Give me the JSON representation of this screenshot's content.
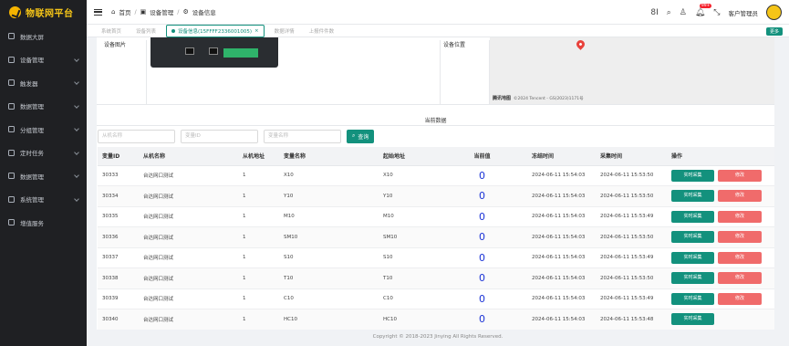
{
  "app": {
    "title": "物联网平台"
  },
  "sidebar": {
    "items": [
      {
        "label": "数据大屏",
        "icon": "monitor-icon",
        "has_children": false
      },
      {
        "label": "设备管理",
        "icon": "device-icon",
        "has_children": true
      },
      {
        "label": "触发器",
        "icon": "trigger-icon",
        "has_children": true
      },
      {
        "label": "数据管理",
        "icon": "data-icon",
        "has_children": true
      },
      {
        "label": "分组管理",
        "icon": "group-icon",
        "has_children": true
      },
      {
        "label": "定时任务",
        "icon": "clock-icon",
        "has_children": true
      },
      {
        "label": "数据管理",
        "icon": "data-icon",
        "has_children": true
      },
      {
        "label": "系统管理",
        "icon": "system-icon",
        "has_children": true
      },
      {
        "label": "增值服务",
        "icon": "service-icon",
        "has_children": false
      }
    ]
  },
  "header": {
    "breadcrumb": [
      "首页",
      "设备管理",
      "设备信息"
    ],
    "badge": "99+",
    "user": "客户管理员"
  },
  "tabs": {
    "items": [
      {
        "label": "系统首页",
        "active": false
      },
      {
        "label": "设备列表",
        "active": false
      },
      {
        "label": "设备信息(15FFFF2336001005)",
        "active": true
      },
      {
        "label": "数据详情",
        "active": false
      },
      {
        "label": "上报件件数",
        "active": false
      }
    ],
    "more": "更多"
  },
  "device_info": {
    "photo_label": "设备图片",
    "location_label": "设备位置",
    "map_brand": "腾讯地图",
    "map_copyright": "©2024 Tencent - GS(2023)1171号"
  },
  "section_title": "当前数据",
  "search": {
    "slave_name_placeholder": "从机名称",
    "var_id_placeholder": "变量ID",
    "var_name_placeholder": "变量名称",
    "query_label": "查询"
  },
  "table": {
    "columns": [
      "变量ID",
      "从机名称",
      "从机地址",
      "变量名称",
      "起始地址",
      "当前值",
      "冻结时间",
      "采集时间",
      "操作"
    ],
    "rows": [
      [
        "30333",
        "台达网口测试",
        "1",
        "X10",
        "X10",
        "0",
        "2024-06-11 15:54:03",
        "2024-06-11 15:53:50"
      ],
      [
        "30334",
        "台达网口测试",
        "1",
        "Y10",
        "Y10",
        "0",
        "2024-06-11 15:54:03",
        "2024-06-11 15:53:50"
      ],
      [
        "30335",
        "台达网口测试",
        "1",
        "M10",
        "M10",
        "0",
        "2024-06-11 15:54:03",
        "2024-06-11 15:53:49"
      ],
      [
        "30336",
        "台达网口测试",
        "1",
        "SM10",
        "SM10",
        "0",
        "2024-06-11 15:54:03",
        "2024-06-11 15:53:50"
      ],
      [
        "30337",
        "台达网口测试",
        "1",
        "S10",
        "S10",
        "0",
        "2024-06-11 15:54:03",
        "2024-06-11 15:53:49"
      ],
      [
        "30338",
        "台达网口测试",
        "1",
        "T10",
        "T10",
        "0",
        "2024-06-11 15:54:03",
        "2024-06-11 15:53:50"
      ],
      [
        "30339",
        "台达网口测试",
        "1",
        "C10",
        "C10",
        "0",
        "2024-06-11 15:54:03",
        "2024-06-11 15:53:49"
      ],
      [
        "30340",
        "台达网口测试",
        "1",
        "HC10",
        "HC10",
        "0",
        "2024-06-11 15:54:03",
        "2024-06-11 15:53:48"
      ]
    ],
    "realtime_label": "实时采集",
    "edit_label": "修改"
  },
  "footer": {
    "text": "Copyright © 2018-2023 Jinying All Rights Reserved."
  },
  "colors": {
    "primary": "#13917d",
    "danger": "#f06b6b",
    "value": "#1a32d6",
    "sidebar_bg": "#1f2023",
    "logo": "#f5c518"
  }
}
